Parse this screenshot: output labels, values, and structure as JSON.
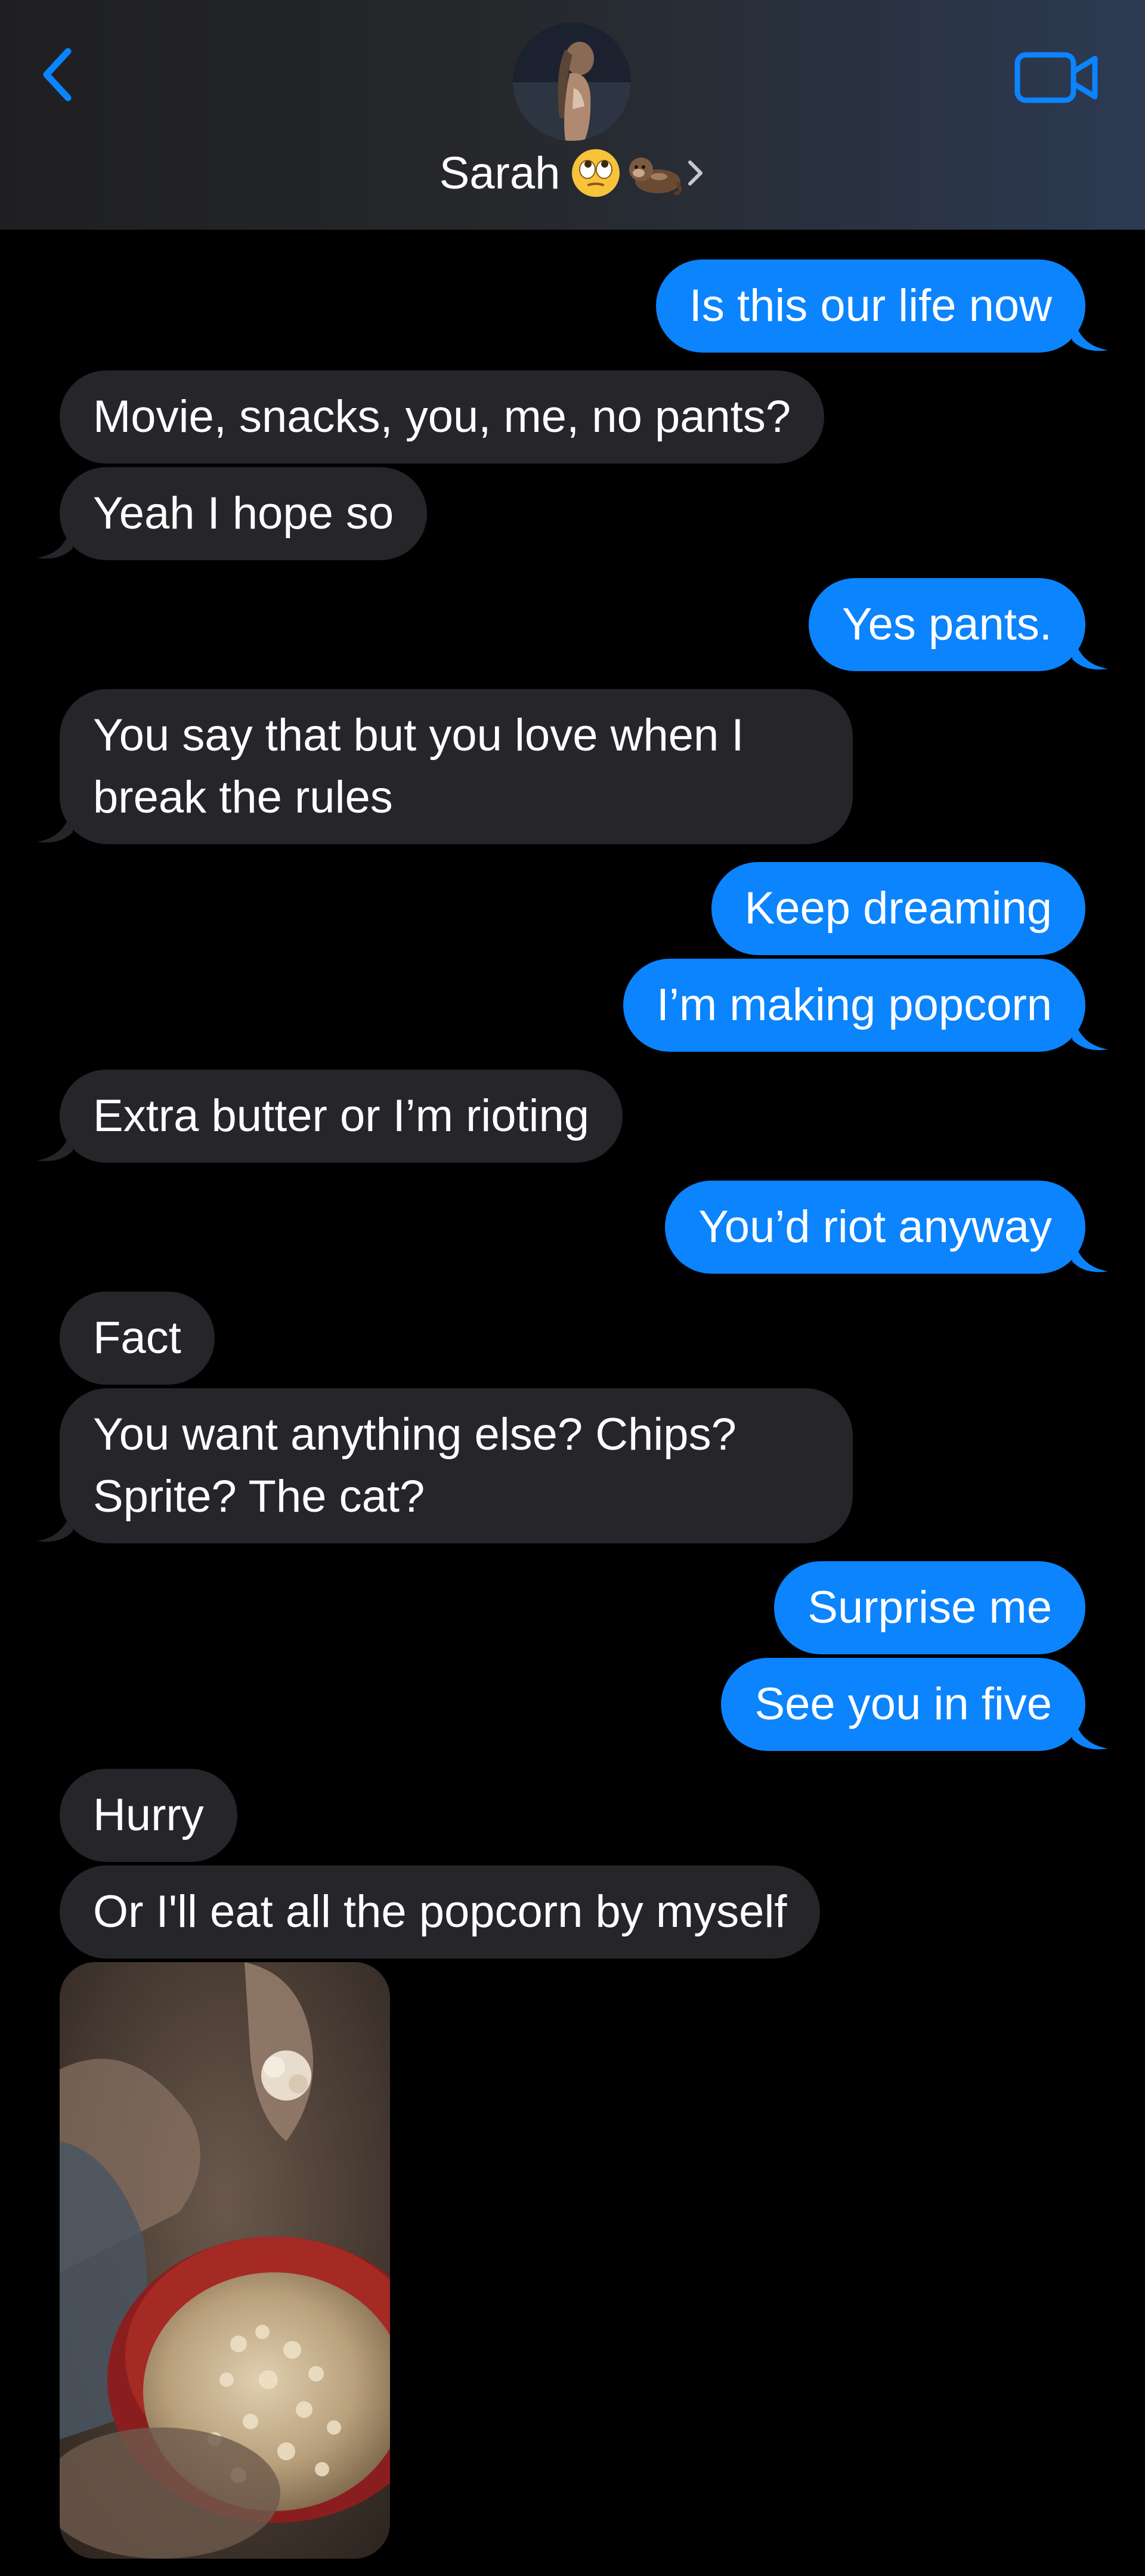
{
  "header": {
    "contact_name": "Sarah",
    "back_icon": "chevron-left-icon",
    "video_icon": "video-camera-icon",
    "name_emojis": [
      "face-with-rolling-eyes-emoji",
      "otter-emoji"
    ],
    "accent_color": "#0b84fe"
  },
  "messages": [
    {
      "from": "me",
      "text": "Is this our life now"
    },
    {
      "from": "them",
      "text": "Movie, snacks, you, me, no pants?"
    },
    {
      "from": "them",
      "text": "Yeah I hope so"
    },
    {
      "from": "me",
      "text": "Yes pants."
    },
    {
      "from": "them",
      "text": "You say that but you love when I break the rules"
    },
    {
      "from": "me",
      "text": "Keep dreaming"
    },
    {
      "from": "me",
      "text": "I’m making popcorn"
    },
    {
      "from": "them",
      "text": "Extra butter or I’m rioting"
    },
    {
      "from": "me",
      "text": "You’d riot anyway"
    },
    {
      "from": "them",
      "text": "Fact"
    },
    {
      "from": "them",
      "text": "You want anything else? Chips? Sprite? The cat?"
    },
    {
      "from": "me",
      "text": "Surprise me"
    },
    {
      "from": "me",
      "text": "See you in five"
    },
    {
      "from": "them",
      "text": "Hurry"
    },
    {
      "from": "them",
      "text": "Or I'll eat all the popcorn by myself"
    }
  ],
  "attachment": {
    "from": "them",
    "kind": "photo",
    "subject": "popcorn-bowl-photo"
  },
  "colors": {
    "sent_bubble": "#0b84fe",
    "received_bubble": "#26252a",
    "background": "#000000"
  }
}
